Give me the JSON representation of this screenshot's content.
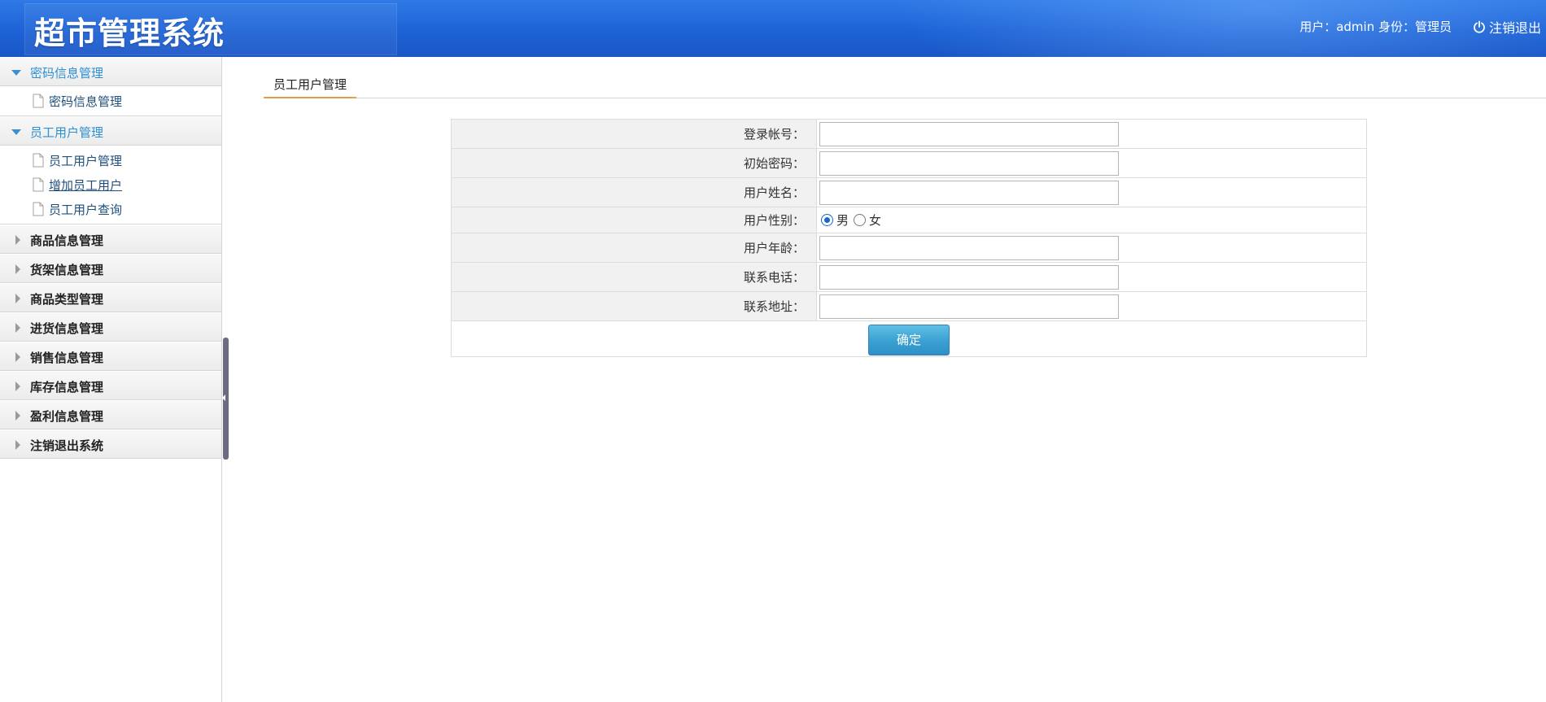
{
  "header": {
    "title": "超市管理系统",
    "user_info": "用户：admin 身份：管理员",
    "logout_label": "注销退出"
  },
  "sidebar": {
    "groups": [
      {
        "label": "密码信息管理",
        "expanded": true,
        "items": [
          {
            "label": "密码信息管理"
          }
        ]
      },
      {
        "label": "员工用户管理",
        "expanded": true,
        "items": [
          {
            "label": "员工用户管理"
          },
          {
            "label": "增加员工用户",
            "active": true
          },
          {
            "label": "员工用户查询"
          }
        ]
      },
      {
        "label": "商品信息管理",
        "expanded": false
      },
      {
        "label": "货架信息管理",
        "expanded": false
      },
      {
        "label": "商品类型管理",
        "expanded": false
      },
      {
        "label": "进货信息管理",
        "expanded": false
      },
      {
        "label": "销售信息管理",
        "expanded": false
      },
      {
        "label": "库存信息管理",
        "expanded": false
      },
      {
        "label": "盈利信息管理",
        "expanded": false
      },
      {
        "label": "注销退出系统",
        "expanded": false
      }
    ]
  },
  "main": {
    "tab_label": "员工用户管理",
    "form": {
      "login_account_label": "登录帐号：",
      "login_account_value": "",
      "initial_password_label": "初始密码：",
      "initial_password_value": "",
      "user_name_label": "用户姓名：",
      "user_name_value": "",
      "gender_label": "用户性别：",
      "gender_male": "男",
      "gender_female": "女",
      "gender_selected": "男",
      "age_label": "用户年龄：",
      "age_value": "",
      "phone_label": "联系电话：",
      "phone_value": "",
      "address_label": "联系地址：",
      "address_value": "",
      "submit_label": "确定"
    }
  },
  "colors": {
    "header_blue": "#1d62d6",
    "expanded_accent": "#2c8fd4",
    "tab_underline": "#e0a050",
    "button_blue": "#3aa0d2"
  }
}
